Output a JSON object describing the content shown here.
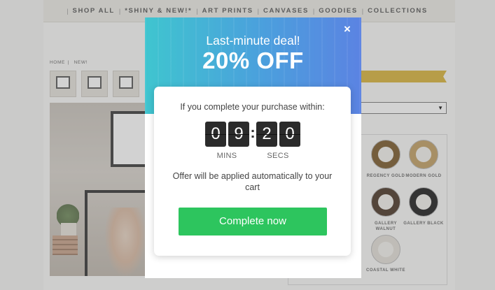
{
  "nav": {
    "items": [
      "SHOP ALL",
      "*SHINY & NEW!*",
      "ART PRINTS",
      "CANVASES",
      "GOODIES",
      "COLLECTIONS"
    ]
  },
  "breadcrumb": [
    "HOME",
    "NEW!"
  ],
  "frame_options": [
    {
      "label": "REGENCY GOLD",
      "color": "#7a5a2a"
    },
    {
      "label": "MODERN GOLD",
      "color": "#c2a063"
    },
    {
      "label": "GALLERY WALNUT",
      "color": "#4a3526"
    },
    {
      "label": "GALLERY BLACK",
      "color": "#1e1e1e"
    },
    {
      "label": "COASTAL WHITE",
      "color": "#e4e0d8"
    }
  ],
  "modal": {
    "subtitle": "Last-minute deal!",
    "title": "20% OFF",
    "intro": "If you complete your purchase within:",
    "timer": {
      "minutes": [
        "0",
        "9"
      ],
      "seconds": [
        "2",
        "0"
      ],
      "mins_label": "MINS",
      "secs_label": "SECS"
    },
    "note": "Offer will be applied automatically to your cart",
    "cta_label": "Complete now",
    "close_icon": "close-icon"
  },
  "colors": {
    "header_gradient_start": "#3fc5cf",
    "header_gradient_end": "#5b83e2",
    "cta": "#2dc55e",
    "ribbon": "#d9b33a"
  }
}
